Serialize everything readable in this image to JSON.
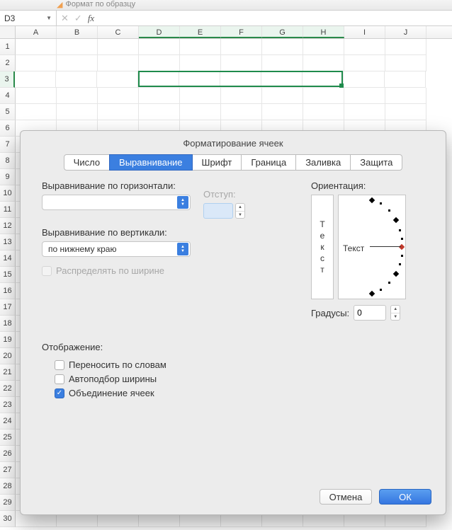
{
  "ribbon": {
    "format_painter": "Формат по образцу"
  },
  "formula_bar": {
    "cell_ref": "D3",
    "fx_label": "fx",
    "value": ""
  },
  "sheet": {
    "columns": [
      "A",
      "B",
      "C",
      "D",
      "E",
      "F",
      "G",
      "H",
      "I",
      "J"
    ],
    "selected_cols": [
      "D",
      "E",
      "F",
      "G",
      "H"
    ],
    "rows": [
      1,
      2,
      3,
      4,
      5,
      6,
      7,
      8,
      9,
      10,
      11,
      12,
      13,
      14,
      15,
      16,
      17,
      18,
      19,
      20,
      21,
      22,
      23,
      24,
      25,
      26,
      27,
      28,
      29,
      30
    ],
    "selected_row": 3
  },
  "dialog": {
    "title": "Форматирование ячеек",
    "tabs": [
      "Число",
      "Выравнивание",
      "Шрифт",
      "Граница",
      "Заливка",
      "Защита"
    ],
    "active_tab": "Выравнивание",
    "align": {
      "h_label": "Выравнивание по горизонтали:",
      "h_value": "",
      "indent_label": "Отступ:",
      "indent_value": "",
      "v_label": "Выравнивание по вертикали:",
      "v_value": "по нижнему краю",
      "distribute_label": "Распределять по ширине",
      "distribute_checked": false,
      "distribute_enabled": false
    },
    "orientation": {
      "label": "Ориентация:",
      "vertical_text": "Текст",
      "horizontal_text": "Текст",
      "degrees_label": "Градусы:",
      "degrees_value": "0"
    },
    "display": {
      "header": "Отображение:",
      "wrap_label": "Переносить по словам",
      "wrap_checked": false,
      "shrink_label": "Автоподбор ширины",
      "shrink_checked": false,
      "merge_label": "Объединение ячеек",
      "merge_checked": true
    },
    "buttons": {
      "cancel": "Отмена",
      "ok": "ОК"
    }
  }
}
